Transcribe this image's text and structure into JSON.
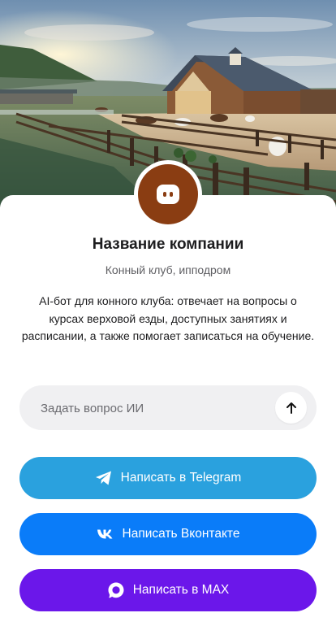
{
  "hero": {
    "image": "horse-ranch-sunrise"
  },
  "profile": {
    "avatar_icon": "chat-bot-icon",
    "avatar_color": "#8a3d12",
    "company_name": "Название компании",
    "category": "Конный клуб, ипподром",
    "description": "AI-бот для конного клуба: отвечает на вопросы о курсах верховой езды, доступных занятиях и расписании, а также помогает записаться на обучение."
  },
  "ask": {
    "placeholder": "Задать вопрос ИИ",
    "send_icon": "arrow-up-icon"
  },
  "buttons": {
    "telegram": {
      "label": "Написать в Telegram",
      "icon": "telegram-icon",
      "color": "#2aa1de"
    },
    "vk": {
      "label": "Написать Вконтакте",
      "icon": "vk-icon",
      "color": "#0a7cf9"
    },
    "max": {
      "label": "Написать в MAX",
      "icon": "max-icon",
      "color": "#6b17ea"
    }
  }
}
